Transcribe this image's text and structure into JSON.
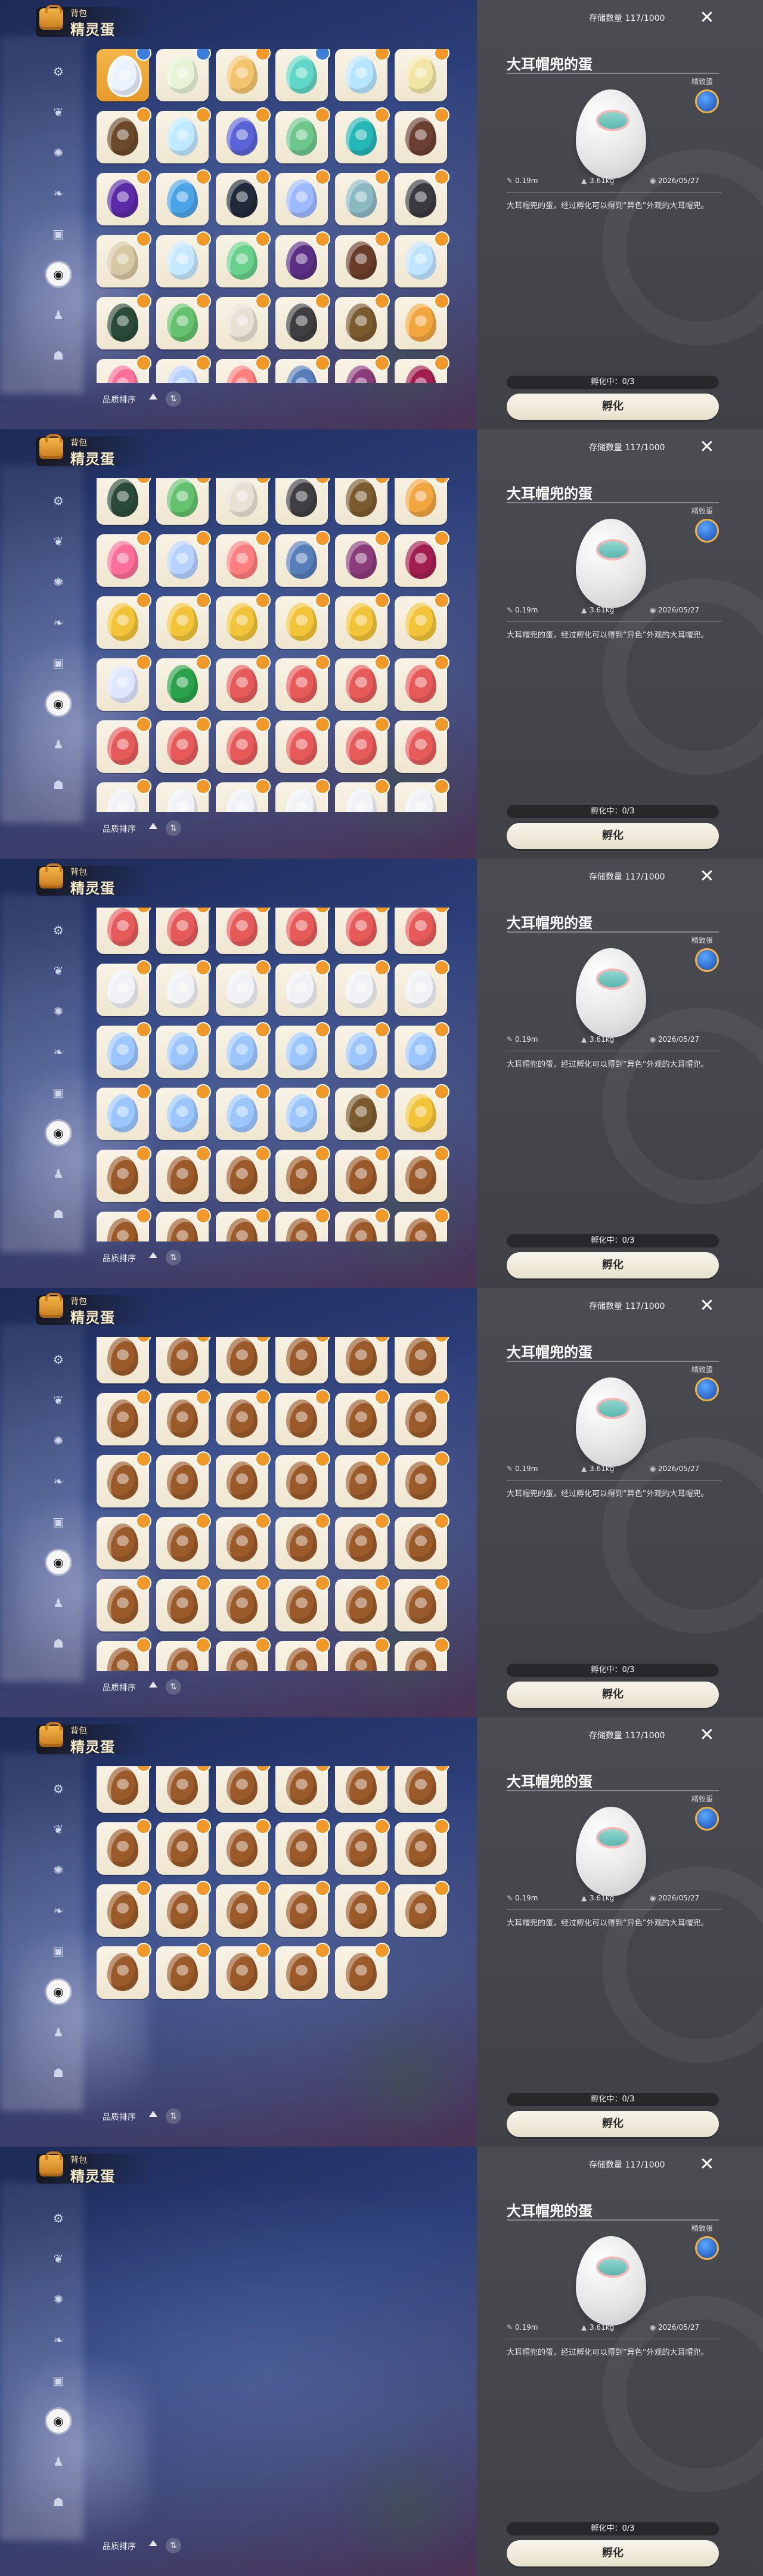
{
  "ui": {
    "bag_label": "背包",
    "page_title": "精灵蛋",
    "sort_label": "品质排序",
    "sort_toggle_glyph": "⇅",
    "storage_text": "存储数量 117/1000",
    "close_glyph": "✕",
    "egg_name": "大耳帽兜的蛋",
    "quality_tag": "精致蛋",
    "stats": [
      {
        "icon": "✎",
        "text": "0.19m"
      },
      {
        "icon": "▲",
        "text": "3.61kg"
      },
      {
        "icon": "◉",
        "text": "2026/05/27"
      }
    ],
    "description": "大耳帽兜的蛋，经过孵化可以得到“异色”外观的大耳帽兜。",
    "hatch_status": "孵化中：0/3",
    "hatch_button": "孵化"
  },
  "sidebar": {
    "items": [
      {
        "glyph": "⚙"
      },
      {
        "glyph": "❦"
      },
      {
        "glyph": "✺"
      },
      {
        "glyph": "❧"
      },
      {
        "glyph": "▣"
      },
      {
        "glyph": "◉",
        "active": true
      },
      {
        "glyph": "♟"
      },
      {
        "glyph": "☗"
      }
    ]
  },
  "colors": {
    "accent": "#f3b64a",
    "panel": "#45474c",
    "cell": "#f5efe0"
  },
  "screens": [
    {
      "scroll_rows": 0,
      "badges_enabled": true
    },
    {
      "scroll_rows": 4,
      "badges_enabled": true
    },
    {
      "scroll_rows": 8,
      "badges_enabled": true
    },
    {
      "scroll_rows": 12,
      "badges_enabled": true
    },
    {
      "scroll_rows": 16,
      "badges_enabled": true
    },
    {
      "scroll_rows": 20,
      "badges_enabled": true
    }
  ],
  "eggs": [
    {
      "c": "#eaf2ff",
      "badge": "blue",
      "selected": true
    },
    {
      "c": "#e7f2d6",
      "badge": "blue"
    },
    {
      "c": "#f3c46e",
      "badge": "orange"
    },
    {
      "c": "#61d7c7",
      "badge": "blue"
    },
    {
      "c": "#b6e6ff",
      "badge": "orange"
    },
    {
      "c": "#f1e6a6",
      "badge": "orange"
    },
    {
      "c": "#6a4a2a",
      "badge": "orange"
    },
    {
      "c": "#bfe9ff",
      "badge": "orange"
    },
    {
      "c": "#5b64d6",
      "badge": "orange"
    },
    {
      "c": "#6dc78d",
      "badge": "orange"
    },
    {
      "c": "#25b6b6",
      "badge": "orange"
    },
    {
      "c": "#6b4032",
      "badge": "orange"
    },
    {
      "c": "#5b2aa6",
      "badge": "orange"
    },
    {
      "c": "#4aa4e6",
      "badge": "orange"
    },
    {
      "c": "#202a3a",
      "badge": "orange"
    },
    {
      "c": "#9db9ff",
      "badge": "orange"
    },
    {
      "c": "#8bb9c2",
      "badge": "orange"
    },
    {
      "c": "#3a3b40",
      "badge": "orange"
    },
    {
      "c": "#d8c7a3",
      "badge": "orange"
    },
    {
      "c": "#c6e9ff",
      "badge": "orange"
    },
    {
      "c": "#6ad18c",
      "badge": "orange"
    },
    {
      "c": "#5a2f84",
      "badge": "orange"
    },
    {
      "c": "#6a3d2b",
      "badge": "orange"
    },
    {
      "c": "#bfe4ff",
      "badge": "orange"
    },
    {
      "c": "#2b4b3a",
      "badge": "orange"
    },
    {
      "c": "#64c16d",
      "badge": "orange"
    },
    {
      "c": "#e7e1d4",
      "badge": "orange"
    },
    {
      "c": "#3f3f42",
      "badge": "orange"
    },
    {
      "c": "#7a5a2f",
      "badge": "orange"
    },
    {
      "c": "#f2a640",
      "badge": "orange"
    },
    {
      "c": "#ff6f99",
      "badge": "orange"
    },
    {
      "c": "#b7d2ff",
      "badge": "orange"
    },
    {
      "c": "#ff7e7e",
      "badge": "orange"
    },
    {
      "c": "#567eb9",
      "badge": "orange"
    },
    {
      "c": "#8a3d7a",
      "badge": "orange"
    },
    {
      "c": "#a21e4f",
      "badge": "orange"
    },
    {
      "c": "#f2c43a",
      "badge": "orange"
    },
    {
      "c": "#f2c43a",
      "badge": "orange"
    },
    {
      "c": "#f2c43a",
      "badge": "orange"
    },
    {
      "c": "#f2c43a",
      "badge": "orange"
    },
    {
      "c": "#f2c43a",
      "badge": "orange"
    },
    {
      "c": "#f2c43a",
      "badge": "orange"
    },
    {
      "c": "#dfe6ff",
      "badge": "orange"
    },
    {
      "c": "#2aa24b",
      "badge": "orange"
    },
    {
      "c": "#e65a5a",
      "badge": "orange"
    },
    {
      "c": "#e65a5a",
      "badge": "orange"
    },
    {
      "c": "#e65a5a",
      "badge": "orange"
    },
    {
      "c": "#e65a5a",
      "badge": "orange"
    },
    {
      "c": "#e65a5a",
      "badge": "orange"
    },
    {
      "c": "#e65a5a",
      "badge": "orange"
    },
    {
      "c": "#e65a5a",
      "badge": "orange"
    },
    {
      "c": "#e65a5a",
      "badge": "orange"
    },
    {
      "c": "#e65a5a",
      "badge": "orange"
    },
    {
      "c": "#e65a5a",
      "badge": "orange"
    },
    {
      "c": "#f0f2f6",
      "badge": "orange"
    },
    {
      "c": "#f0f2f6",
      "badge": "orange"
    },
    {
      "c": "#f0f2f6",
      "badge": "orange"
    },
    {
      "c": "#f0f2f6",
      "badge": "orange"
    },
    {
      "c": "#f0f2f6",
      "badge": "orange"
    },
    {
      "c": "#f0f2f6",
      "badge": "orange"
    },
    {
      "c": "#9cc6ff",
      "badge": "orange"
    },
    {
      "c": "#9cc6ff",
      "badge": "orange"
    },
    {
      "c": "#9cc6ff",
      "badge": "orange"
    },
    {
      "c": "#9cc6ff",
      "badge": "orange"
    },
    {
      "c": "#9cc6ff",
      "badge": "orange"
    },
    {
      "c": "#9cc6ff",
      "badge": "orange"
    },
    {
      "c": "#9cc6ff",
      "badge": "orange"
    },
    {
      "c": "#9cc6ff",
      "badge": "orange"
    },
    {
      "c": "#9cc6ff",
      "badge": "orange"
    },
    {
      "c": "#9cc6ff",
      "badge": "orange"
    },
    {
      "c": "#7a5a2f",
      "badge": "orange"
    },
    {
      "c": "#f2c43a",
      "badge": "orange"
    },
    {
      "c": "#9b5a2a",
      "badge": "orange"
    },
    {
      "c": "#9b5a2a",
      "badge": "orange"
    },
    {
      "c": "#9b5a2a",
      "badge": "orange"
    },
    {
      "c": "#9b5a2a",
      "badge": "orange"
    },
    {
      "c": "#9b5a2a",
      "badge": "orange"
    },
    {
      "c": "#9b5a2a",
      "badge": "orange"
    },
    {
      "c": "#9b5a2a",
      "badge": "orange"
    },
    {
      "c": "#9b5a2a",
      "badge": "orange"
    },
    {
      "c": "#9b5a2a",
      "badge": "orange"
    },
    {
      "c": "#9b5a2a",
      "badge": "orange"
    },
    {
      "c": "#9b5a2a",
      "badge": "orange"
    },
    {
      "c": "#9b5a2a",
      "badge": "orange"
    },
    {
      "c": "#9b5a2a",
      "badge": "orange"
    },
    {
      "c": "#9b5a2a",
      "badge": "orange"
    },
    {
      "c": "#9b5a2a",
      "badge": "orange"
    },
    {
      "c": "#9b5a2a",
      "badge": "orange"
    },
    {
      "c": "#9b5a2a",
      "badge": "orange"
    },
    {
      "c": "#9b5a2a",
      "badge": "orange"
    },
    {
      "c": "#9b5a2a",
      "badge": "orange"
    },
    {
      "c": "#9b5a2a",
      "badge": "orange"
    },
    {
      "c": "#9b5a2a",
      "badge": "orange"
    },
    {
      "c": "#9b5a2a",
      "badge": "orange"
    },
    {
      "c": "#9b5a2a",
      "badge": "orange"
    },
    {
      "c": "#9b5a2a",
      "badge": "orange"
    },
    {
      "c": "#9b5a2a",
      "badge": "orange"
    },
    {
      "c": "#9b5a2a",
      "badge": "orange"
    },
    {
      "c": "#9b5a2a",
      "badge": "orange"
    },
    {
      "c": "#9b5a2a",
      "badge": "orange"
    },
    {
      "c": "#9b5a2a",
      "badge": "orange"
    },
    {
      "c": "#9b5a2a",
      "badge": "orange"
    },
    {
      "c": "#9b5a2a",
      "badge": "orange"
    },
    {
      "c": "#9b5a2a",
      "badge": "orange"
    },
    {
      "c": "#9b5a2a",
      "badge": "orange"
    },
    {
      "c": "#9b5a2a",
      "badge": "orange"
    },
    {
      "c": "#9b5a2a",
      "badge": "orange"
    },
    {
      "c": "#9b5a2a",
      "badge": "orange"
    },
    {
      "c": "#9b5a2a",
      "badge": "orange"
    },
    {
      "c": "#9b5a2a",
      "badge": "orange"
    },
    {
      "c": "#9b5a2a",
      "badge": "orange"
    },
    {
      "c": "#9b5a2a",
      "badge": "orange"
    },
    {
      "c": "#9b5a2a",
      "badge": "orange"
    },
    {
      "c": "#9b5a2a",
      "badge": "orange"
    },
    {
      "c": "#9b5a2a",
      "badge": "orange"
    },
    {
      "c": "#9b5a2a",
      "badge": "orange"
    },
    {
      "c": "#9b5a2a",
      "badge": "orange"
    },
    {
      "c": "#9b5a2a",
      "badge": "orange"
    },
    {
      "c": "#9b5a2a",
      "badge": "orange"
    }
  ]
}
